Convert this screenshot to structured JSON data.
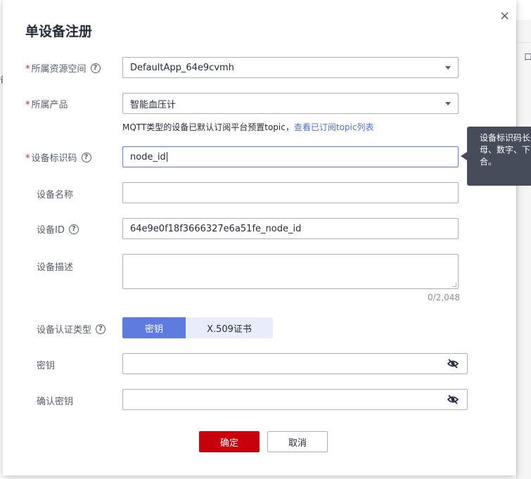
{
  "background": {
    "right_partial_text": "口",
    "left_partial_text": "备"
  },
  "dialog": {
    "title": "单设备注册",
    "close_symbol": "×",
    "fields": {
      "space": {
        "label": "所属资源空间",
        "required": true,
        "value": "DefaultApp_64e9cvmh"
      },
      "product": {
        "label": "所属产品",
        "required": true,
        "value": "智能血压计"
      },
      "hint": {
        "text": "MQTT类型的设备已默认订阅平台预置topic，",
        "link": "查看已订阅topic列表"
      },
      "node_id": {
        "label": "设备标识码",
        "required": true,
        "value": "node_id"
      },
      "device_name": {
        "label": "设备名称",
        "value": ""
      },
      "device_id": {
        "label": "设备ID",
        "value": "64e9e0f18f3666327e6a51fe_node_id"
      },
      "description": {
        "label": "设备描述",
        "value": "",
        "counter": "0/2,048"
      },
      "auth_type": {
        "label": "设备认证类型",
        "options": [
          "密钥",
          "X.509证书"
        ],
        "selected": "密钥"
      },
      "secret": {
        "label": "密钥",
        "value": ""
      },
      "confirm_secret": {
        "label": "确认密钥",
        "value": ""
      }
    },
    "buttons": {
      "confirm": "确定",
      "cancel": "取消"
    },
    "tooltip": {
      "line1": "设备标识码长",
      "line2": "母、数字、下",
      "line3": "合。"
    }
  },
  "colors": {
    "primary": "#c7000b",
    "accent": "#5e7ce0",
    "link": "#526ecc",
    "required": "#e02020"
  },
  "icons": {
    "help": "question-circle-icon",
    "eye": "eye-hidden-icon",
    "dropdown": "chevron-down-icon",
    "close": "close-icon"
  }
}
